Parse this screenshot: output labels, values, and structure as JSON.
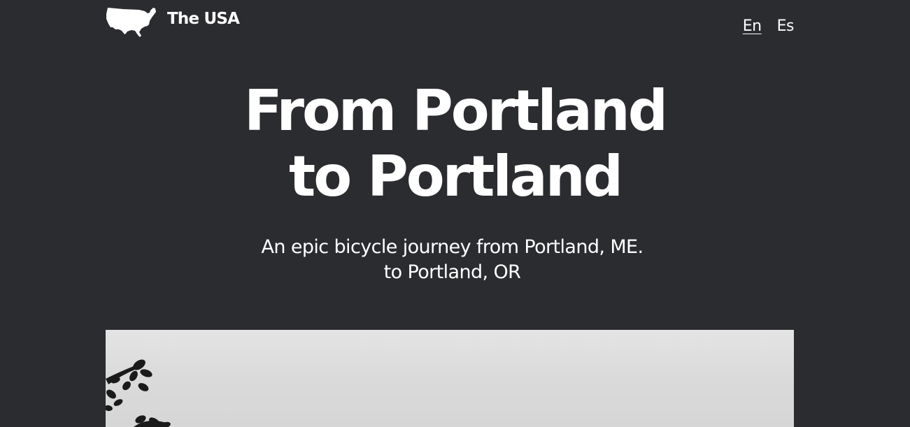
{
  "header": {
    "logo_icon": "usa-map-icon",
    "brand_name": "The USA",
    "languages": [
      {
        "label": "En",
        "active": true
      },
      {
        "label": "Es",
        "active": false
      }
    ]
  },
  "hero": {
    "title_line1": "From Portland",
    "title_line2": "to Portland",
    "subtitle_line1": "An epic bicycle journey from Portland, ME.",
    "subtitle_line2": "to Portland, OR"
  },
  "colors": {
    "background": "#2b2c30",
    "text": "#ffffff",
    "photo_tone": "#dcdcdc"
  }
}
